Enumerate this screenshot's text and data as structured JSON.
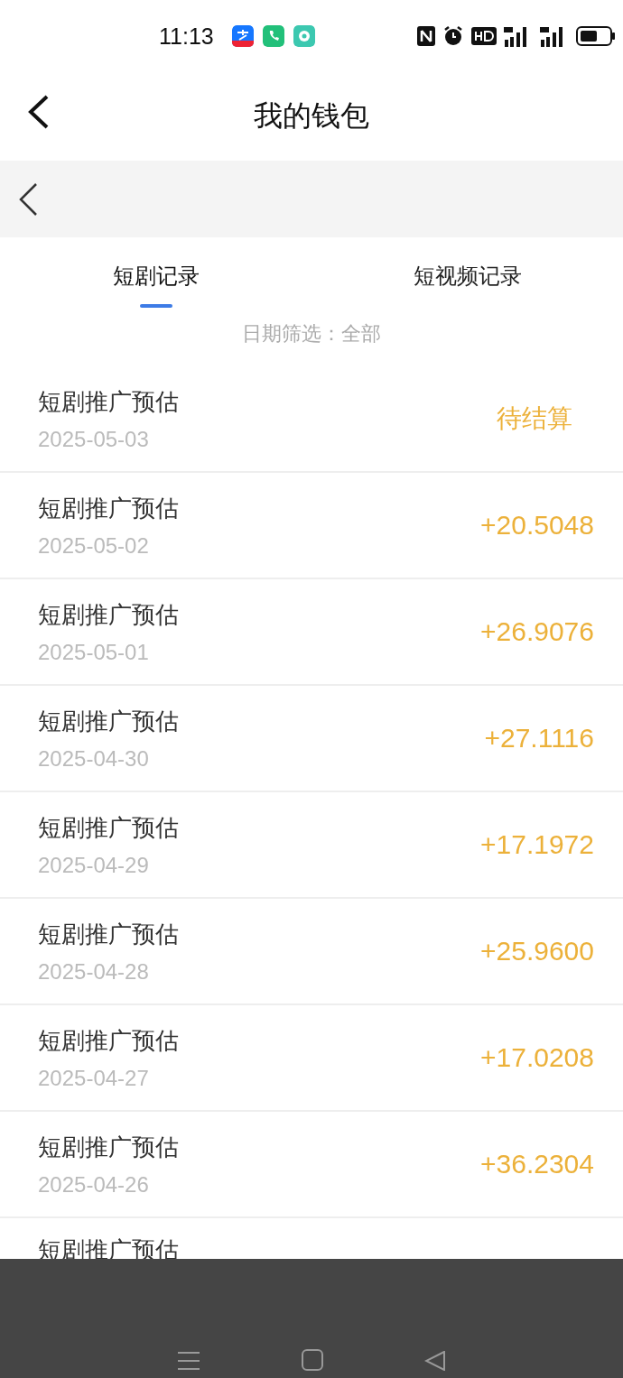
{
  "status_bar": {
    "time": "11:13"
  },
  "header": {
    "title": "我的钱包"
  },
  "tabs": [
    {
      "label": "短剧记录",
      "selected": true
    },
    {
      "label": "短视频记录",
      "selected": false
    }
  ],
  "filter": {
    "label": "日期筛选：全部"
  },
  "records": [
    {
      "title": "短剧推广预估",
      "date": "2025-05-03",
      "amount": "待结算",
      "kind": "pending"
    },
    {
      "title": "短剧推广预估",
      "date": "2025-05-02",
      "amount": "+20.5048",
      "kind": "income"
    },
    {
      "title": "短剧推广预估",
      "date": "2025-05-01",
      "amount": "+26.9076",
      "kind": "income"
    },
    {
      "title": "短剧推广预估",
      "date": "2025-04-30",
      "amount": "+27.1116",
      "kind": "income"
    },
    {
      "title": "短剧推广预估",
      "date": "2025-04-29",
      "amount": "+17.1972",
      "kind": "income"
    },
    {
      "title": "短剧推广预估",
      "date": "2025-04-28",
      "amount": "+25.9600",
      "kind": "income"
    },
    {
      "title": "短剧推广预估",
      "date": "2025-04-27",
      "amount": "+17.0208",
      "kind": "income"
    },
    {
      "title": "短剧推广预估",
      "date": "2025-04-26",
      "amount": "+36.2304",
      "kind": "income"
    },
    {
      "title": "短剧推广预估",
      "kind": "partial"
    }
  ]
}
